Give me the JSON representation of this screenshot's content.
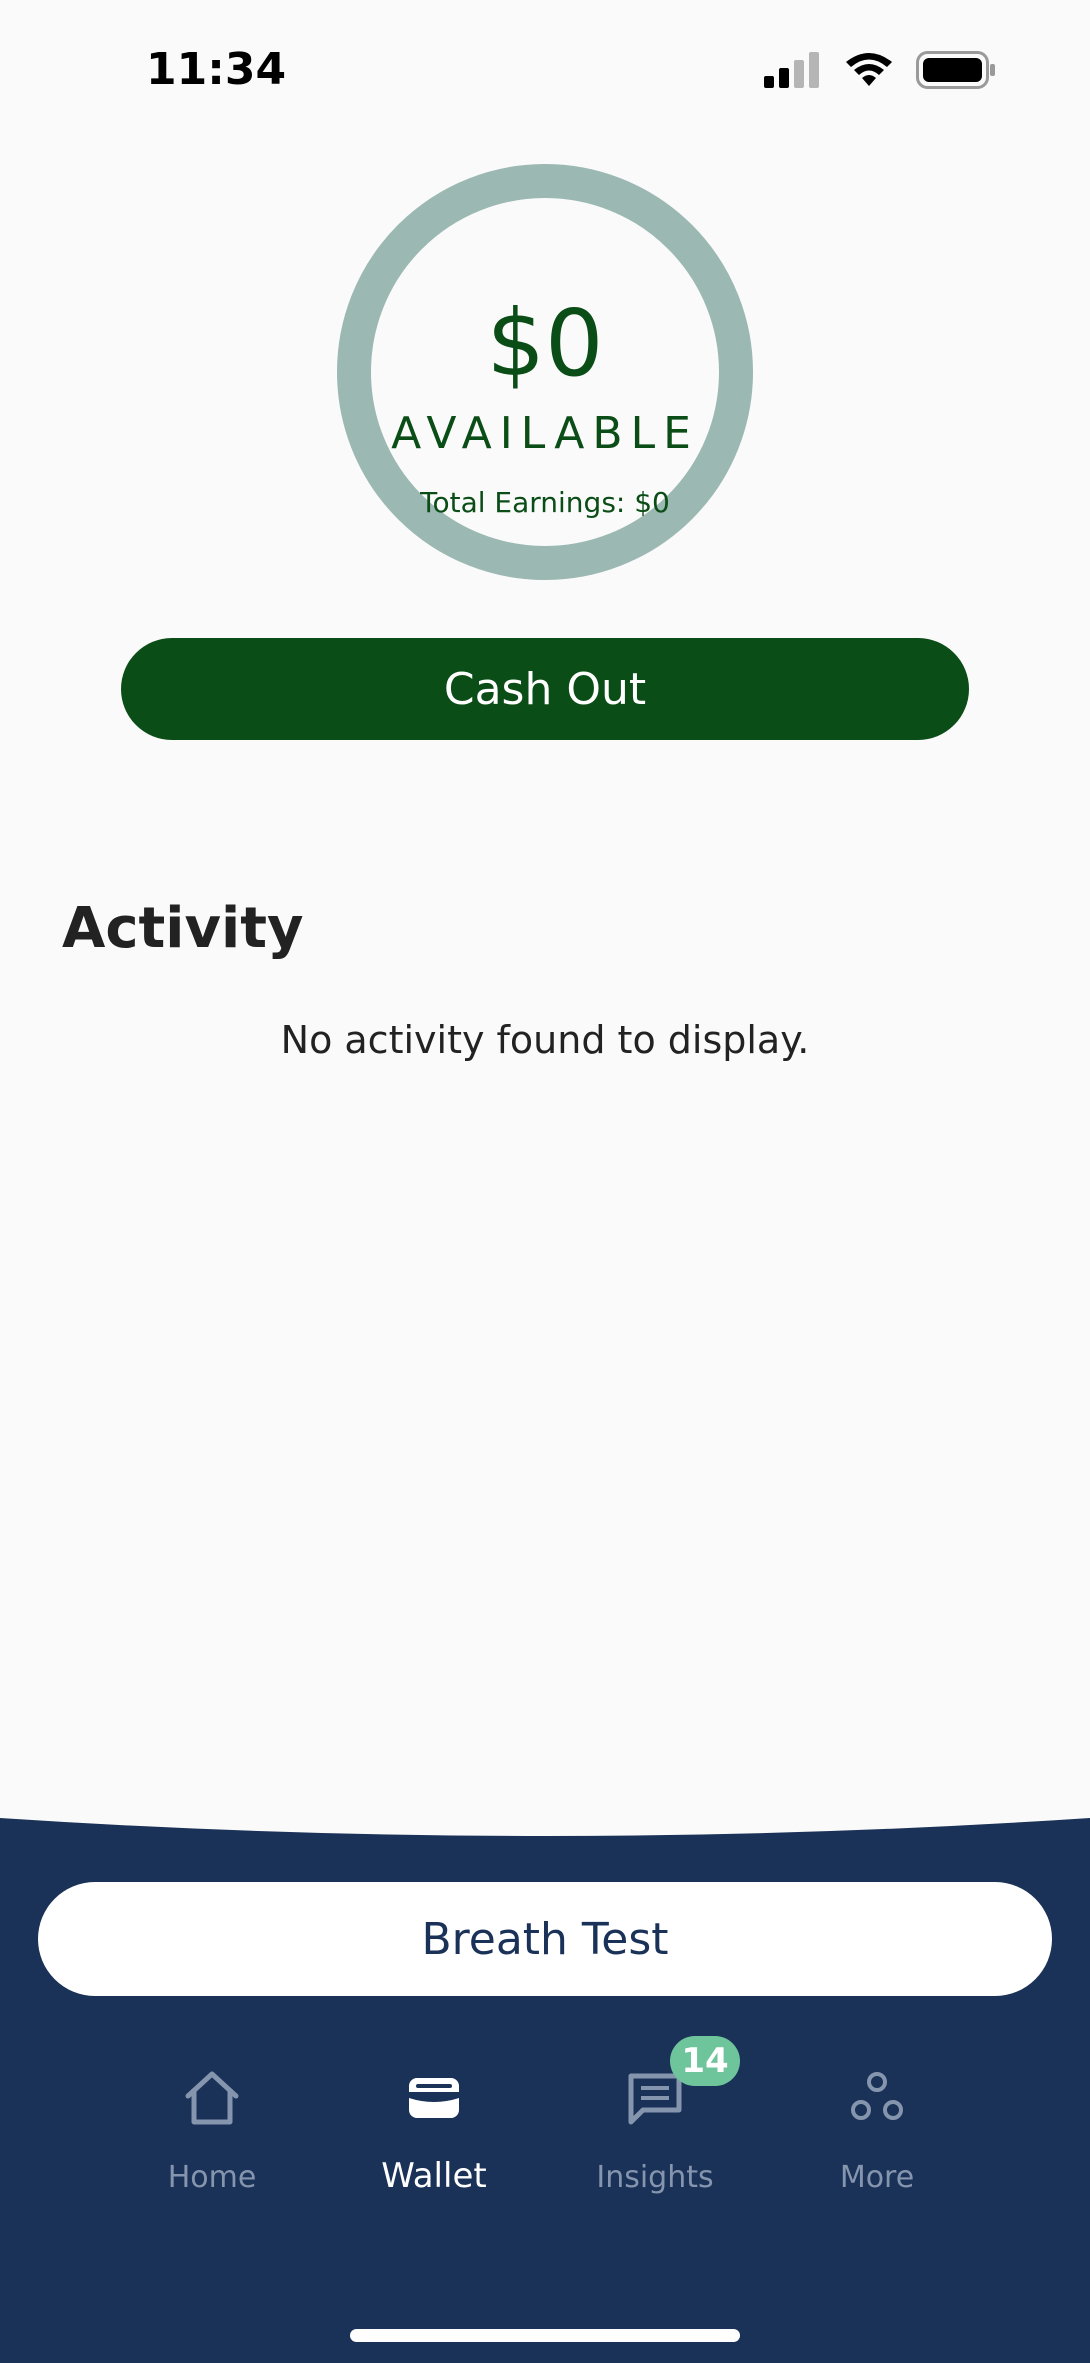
{
  "status_bar": {
    "time": "11:34"
  },
  "balance": {
    "amount": "$0",
    "label": "AVAILABLE",
    "total_earnings": "Total Earnings: $0"
  },
  "cash_out_label": "Cash Out",
  "activity": {
    "title": "Activity",
    "empty_message": "No activity found to display."
  },
  "breath_test_label": "Breath Test",
  "tabs": [
    {
      "label": "Home",
      "icon": "home-icon",
      "active": false
    },
    {
      "label": "Wallet",
      "icon": "wallet-icon",
      "active": true
    },
    {
      "label": "Insights",
      "icon": "chat-icon",
      "active": false,
      "badge": "14"
    },
    {
      "label": "More",
      "icon": "more-icon",
      "active": false
    }
  ],
  "colors": {
    "primary_green": "#0b4d17",
    "ring": "#9bb8b2",
    "nav_bg": "#1a3158",
    "badge": "#6fc59b",
    "inactive_tab": "#8595ae"
  }
}
